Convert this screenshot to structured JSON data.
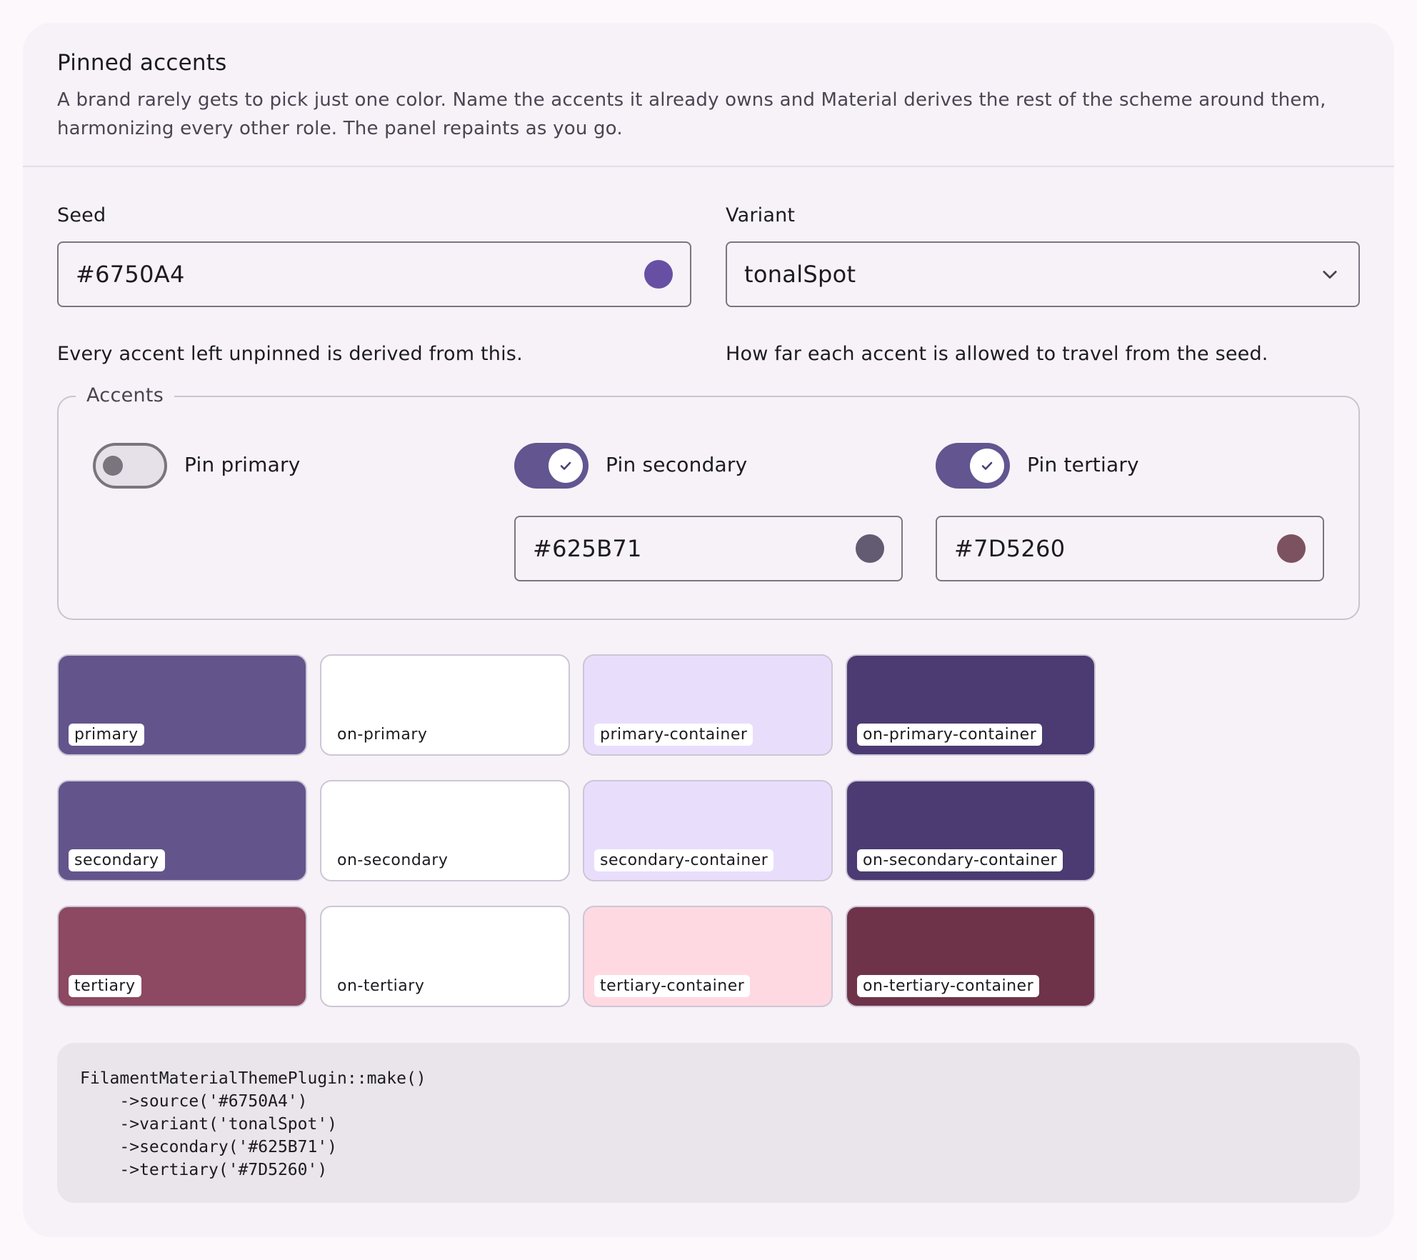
{
  "header": {
    "title": "Pinned accents",
    "description": "A brand rarely gets to pick just one color. Name the accents it already owns and Material derives the rest of the scheme around them, harmonizing every other role. The panel repaints as you go."
  },
  "seed": {
    "label": "Seed",
    "value": "#6750A4",
    "swatch_color": "#6750A4",
    "helper": "Every accent left unpinned is derived from this."
  },
  "variant": {
    "label": "Variant",
    "value": "tonalSpot",
    "helper": "How far each accent is allowed to travel from the seed.",
    "icon": "chevron-down-icon"
  },
  "accents": {
    "legend": "Accents",
    "primary": {
      "label": "Pin primary",
      "pinned": false
    },
    "secondary": {
      "label": "Pin secondary",
      "pinned": true,
      "value": "#625B71",
      "swatch_color": "#625B71"
    },
    "tertiary": {
      "label": "Pin tertiary",
      "pinned": true,
      "value": "#7D5260",
      "swatch_color": "#7D5260"
    }
  },
  "swatches": [
    [
      {
        "label": "primary",
        "color": "#63558C",
        "chip": true
      },
      {
        "label": "on-primary",
        "color": "#FFFFFF",
        "chip": false
      },
      {
        "label": "primary-container",
        "color": "#E8DEFC",
        "chip": true
      },
      {
        "label": "on-primary-container",
        "color": "#4B3B72",
        "chip": true
      }
    ],
    [
      {
        "label": "secondary",
        "color": "#63558C",
        "chip": true
      },
      {
        "label": "on-secondary",
        "color": "#FFFFFF",
        "chip": false
      },
      {
        "label": "secondary-container",
        "color": "#E8DEFC",
        "chip": true
      },
      {
        "label": "on-secondary-container",
        "color": "#4B3B72",
        "chip": true
      }
    ],
    [
      {
        "label": "tertiary",
        "color": "#8C4961",
        "chip": true
      },
      {
        "label": "on-tertiary",
        "color": "#FFFFFF",
        "chip": false
      },
      {
        "label": "tertiary-container",
        "color": "#FFD9E2",
        "chip": true
      },
      {
        "label": "on-tertiary-container",
        "color": "#6F3349",
        "chip": true
      }
    ]
  ],
  "code": {
    "text": "FilamentMaterialThemePlugin::make()\n    ->source('#6750A4')\n    ->variant('tonalSpot')\n    ->secondary('#625B71')\n    ->tertiary('#7D5260')"
  },
  "colors": {
    "switch_on": "#625590",
    "switch_off_track": "#E6E0E9",
    "outline": "#7A7580"
  }
}
